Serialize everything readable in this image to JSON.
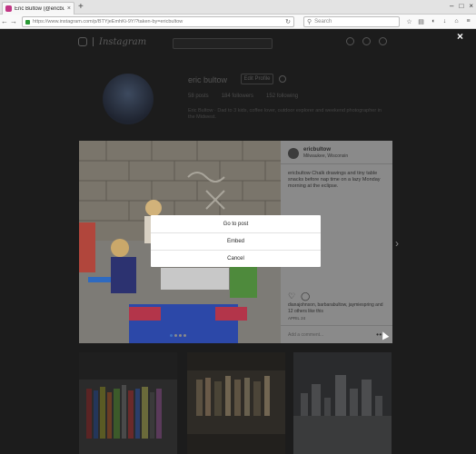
{
  "browser": {
    "tab_title": "Eric Bultow (@ericbultow) • Ins",
    "tab_close": "×",
    "new_tab": "+",
    "window_controls": [
      "–",
      "□",
      "×"
    ],
    "back": "←",
    "forward": "→",
    "url": "https://www.instagram.com/p/BTYjeEmhKi-9Y/?taken-by=ericbultow",
    "reload": "↻",
    "search_placeholder": "Search",
    "toolbar_icons": [
      "star-icon",
      "reader-icon",
      "pocket-icon",
      "download-icon",
      "home-icon",
      "menu-icon"
    ]
  },
  "instagram": {
    "logo": "Instagram",
    "profile_name": "eric bultow",
    "edit_profile": "Edit Profile",
    "stats": [
      "58 posts",
      "184 followers",
      "152 following"
    ],
    "bio": "Eric Bultow · Dad to 3 kids, coffee lover, outdoor explorer and weekend photographer in the Midwest."
  },
  "post": {
    "username": "ericbultow",
    "location": "Milwaukee, Wisconsin",
    "caption": "ericbultow Chalk drawings and tiny table snacks before nap time on a lazy Monday morning at the eclipse.",
    "likes": "dianajohnson, barbarabultow, jaymiespring and 12 others like this",
    "date": "APRIL 24",
    "comment_placeholder": "Add a comment...",
    "more": "•••"
  },
  "sheet": {
    "go_to_post": "Go to post",
    "embed": "Embed",
    "cancel": "Cancel"
  },
  "overlay": {
    "close": "×",
    "next": "›"
  },
  "colors": {
    "accent": "#3e74c7",
    "overlay": "#1c1c1c"
  }
}
